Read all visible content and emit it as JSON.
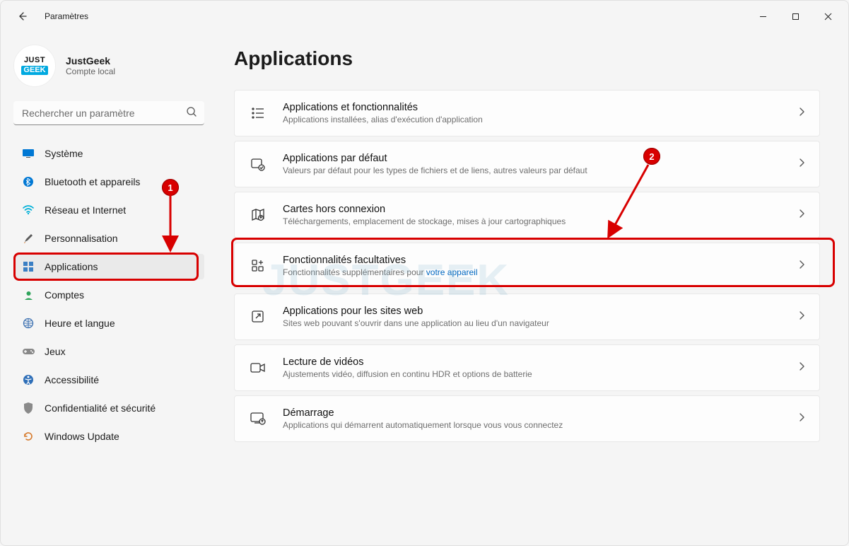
{
  "window": {
    "title": "Paramètres"
  },
  "profile": {
    "name": "JustGeek",
    "subtitle": "Compte local"
  },
  "search": {
    "placeholder": "Rechercher un paramètre"
  },
  "nav": {
    "items": [
      {
        "label": "Système",
        "icon": "💻"
      },
      {
        "label": "Bluetooth et appareils",
        "icon": "bt"
      },
      {
        "label": "Réseau et Internet",
        "icon": "📶"
      },
      {
        "label": "Personnalisation",
        "icon": "🖌"
      },
      {
        "label": "Applications",
        "icon": "apps",
        "active": true
      },
      {
        "label": "Comptes",
        "icon": "👤"
      },
      {
        "label": "Heure et langue",
        "icon": "🌐"
      },
      {
        "label": "Jeux",
        "icon": "🎮"
      },
      {
        "label": "Accessibilité",
        "icon": "a11y"
      },
      {
        "label": "Confidentialité et sécurité",
        "icon": "🛡"
      },
      {
        "label": "Windows Update",
        "icon": "🔄"
      }
    ]
  },
  "page": {
    "title": "Applications"
  },
  "cards": [
    {
      "title": "Applications et fonctionnalités",
      "sub": "Applications installées, alias d'exécution d'application"
    },
    {
      "title": "Applications par défaut",
      "sub": "Valeurs par défaut pour les types de fichiers et de liens, autres valeurs par défaut"
    },
    {
      "title": "Cartes hors connexion",
      "sub": "Téléchargements, emplacement de stockage, mises à jour cartographiques"
    },
    {
      "title": "Fonctionnalités facultatives",
      "sub": "Fonctionnalités supplémentaires pour ",
      "sub_link": "votre appareil"
    },
    {
      "title": "Applications pour les sites web",
      "sub": "Sites web pouvant s'ouvrir dans une application au lieu d'un navigateur"
    },
    {
      "title": "Lecture de vidéos",
      "sub": "Ajustements vidéo, diffusion en continu HDR et options de batterie"
    },
    {
      "title": "Démarrage",
      "sub": "Applications qui démarrent automatiquement lorsque vous vous connectez"
    }
  ],
  "annotations": {
    "badge1": "1",
    "badge2": "2"
  },
  "watermark": "JUSTGEEK"
}
